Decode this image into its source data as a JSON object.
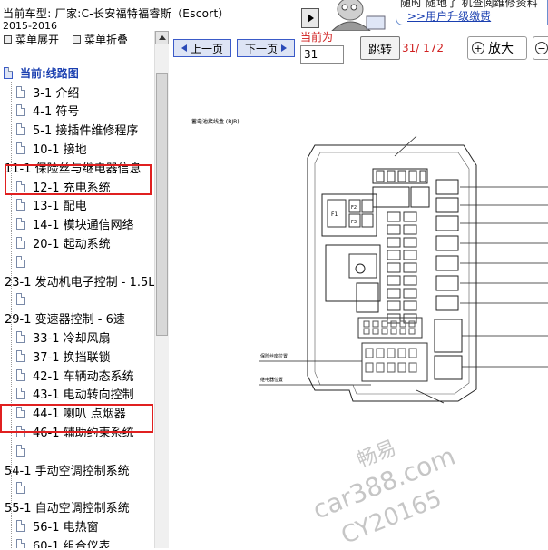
{
  "header": {
    "vehicle_line": "当前车型:   厂家:C-长安福特福睿斯（Escort）",
    "vehicle_year": "2015-2016"
  },
  "promo": {
    "line1": "随时 随地了 机查阅维修资料",
    "line2": ">>用户升级缴费"
  },
  "sidebar": {
    "expand_label": "菜单展开",
    "collapse_label": "菜单折叠",
    "root_label": "当前:线路图",
    "items": [
      {
        "label": "3-1 介绍",
        "level": 1
      },
      {
        "label": "4-1 符号",
        "level": 1
      },
      {
        "label": "5-1 接插件维修程序",
        "level": 1
      },
      {
        "label": "10-1 接地",
        "level": 1
      },
      {
        "label": "11-1 保险丝与继电器信息",
        "level": 0
      },
      {
        "label": "12-1 充电系统",
        "level": 1
      },
      {
        "label": "13-1 配电",
        "level": 1
      },
      {
        "label": "14-1 模块通信网络",
        "level": 1
      },
      {
        "label": "20-1 起动系统",
        "level": 1
      },
      {
        "label": "",
        "level": 1
      },
      {
        "label": "23-1 发动机电子控制 - 1.5L",
        "level": 0
      },
      {
        "label": "",
        "level": 1
      },
      {
        "label": "29-1 变速器控制 - 6速",
        "level": 0
      },
      {
        "label": "33-1 冷却风扇",
        "level": 1
      },
      {
        "label": "37-1 换挡联锁",
        "level": 1
      },
      {
        "label": "42-1 车辆动态系统",
        "level": 1
      },
      {
        "label": "43-1 电动转向控制",
        "level": 1
      },
      {
        "label": "44-1 喇叭 点烟器",
        "level": 1
      },
      {
        "label": "46-1 辅助约束系统",
        "level": 1
      },
      {
        "label": "",
        "level": 1
      },
      {
        "label": "54-1 手动空调控制系统",
        "level": 0
      },
      {
        "label": "",
        "level": 1
      },
      {
        "label": "55-1 自动空调控制系统",
        "level": 0
      },
      {
        "label": "56-1 电热窗",
        "level": 1
      },
      {
        "label": "60-1 组合仪表",
        "level": 1
      }
    ]
  },
  "toolbar": {
    "prev_label": "上一页",
    "next_label": "下一页",
    "current_label": "当前为",
    "page_value": "31",
    "jump_label": "跳转",
    "page_count": "31/ 172",
    "zoom_in_label": "放大"
  },
  "diagram": {
    "title": "蓄电池接线盒 (BJB)",
    "note1": "保险丝座位置",
    "note2": "继电器位置"
  },
  "watermark": {
    "line1": "畅易",
    "line2": "car388.com",
    "line3": "CY20165"
  },
  "colors": {
    "highlight": "#e02020",
    "link_blue": "#1a3fb0",
    "root_blue": "#1a3fb0",
    "button_border": "#3a5ac8",
    "red_text": "#d02020"
  }
}
